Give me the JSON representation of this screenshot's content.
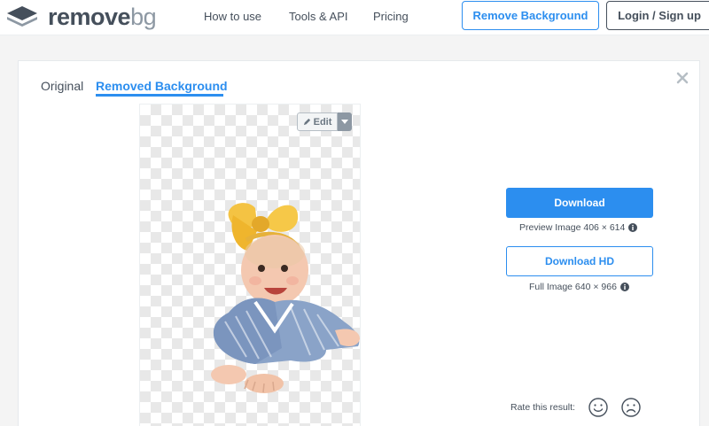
{
  "header": {
    "logo": {
      "remove": "remove",
      "bg": "bg"
    },
    "nav": [
      "How to use",
      "Tools & API",
      "Pricing"
    ],
    "remove_background_button": "Remove Background",
    "login_button": "Login / Sign up"
  },
  "tabs": {
    "original": "Original",
    "removed": "Removed Background"
  },
  "editor": {
    "edit_label": "Edit"
  },
  "download": {
    "button": "Download",
    "preview_info": "Preview Image 406 × 614",
    "hd_button": "Download HD",
    "full_info": "Full Image 640 × 966"
  },
  "rating": {
    "label": "Rate this result:"
  },
  "colors": {
    "accent": "#2c8eef",
    "text": "#454f5b",
    "muted": "#8d98a3"
  },
  "icons": [
    "layers-logo-icon",
    "close-icon",
    "pencil-icon",
    "caret-down-icon",
    "info-icon",
    "happy-face-icon",
    "sad-face-icon"
  ]
}
